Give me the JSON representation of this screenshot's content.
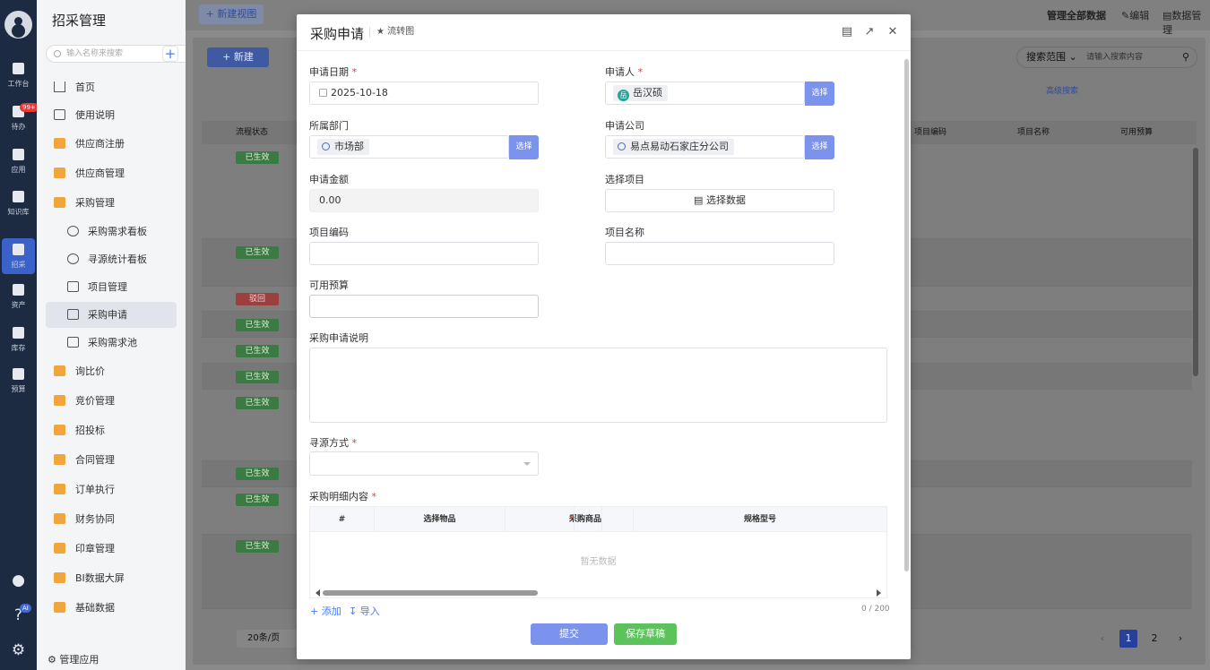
{
  "rail": {
    "items": [
      {
        "label": "工作台",
        "icon": "home-icon"
      },
      {
        "label": "待办",
        "icon": "todo-icon"
      },
      {
        "label": "应用",
        "icon": "apps-icon"
      },
      {
        "label": "知识库",
        "icon": "knowledge-icon"
      },
      {
        "label": "招采",
        "icon": "procurement-icon"
      },
      {
        "label": "资产",
        "icon": "assets-icon"
      },
      {
        "label": "库存",
        "icon": "inventory-icon"
      },
      {
        "label": "预算",
        "icon": "budget-icon"
      }
    ],
    "badge": "99+",
    "ai_badge": "AI"
  },
  "sidebar": {
    "title": "招采管理",
    "search_placeholder": "输入名称来搜索",
    "add": "+",
    "items": [
      {
        "label": "首页",
        "icon": "home-icon"
      },
      {
        "label": "使用说明",
        "icon": "document-icon"
      },
      {
        "label": "供应商注册",
        "icon": "folder-icon"
      },
      {
        "label": "供应商管理",
        "icon": "folder-icon"
      },
      {
        "label": "采购管理",
        "icon": "folder-open-icon"
      },
      {
        "label": "采购需求看板",
        "icon": "dashboard-icon"
      },
      {
        "label": "寻源统计看板",
        "icon": "dashboard-icon"
      },
      {
        "label": "项目管理",
        "icon": "document-icon"
      },
      {
        "label": "采购申请",
        "icon": "document-icon"
      },
      {
        "label": "采购需求池",
        "icon": "document-icon"
      },
      {
        "label": "询比价",
        "icon": "folder-icon"
      },
      {
        "label": "竞价管理",
        "icon": "folder-icon"
      },
      {
        "label": "招投标",
        "icon": "folder-icon"
      },
      {
        "label": "合同管理",
        "icon": "folder-icon"
      },
      {
        "label": "订单执行",
        "icon": "folder-icon"
      },
      {
        "label": "财务协同",
        "icon": "folder-icon"
      },
      {
        "label": "印章管理",
        "icon": "folder-icon"
      },
      {
        "label": "BI数据大屏",
        "icon": "folder-icon"
      },
      {
        "label": "基础数据",
        "icon": "folder-icon"
      }
    ],
    "footer": "管理应用"
  },
  "toolbar": {
    "new_view": "+ 新建视图",
    "manage_all": "管理全部数据",
    "edit": "编辑",
    "data_manage": "数据管理",
    "new_button": "+ 新建",
    "search_scope": "搜索范围",
    "search_placeholder": "请输入搜索内容",
    "advanced_search": "高级搜索"
  },
  "table": {
    "headers": {
      "status": "流程状态",
      "code": "项目编码",
      "name": "项目名称",
      "budget": "可用预算"
    },
    "rows": [
      {
        "status": "已生效"
      },
      {
        "status": "已生效"
      },
      {
        "status": "驳回"
      },
      {
        "status": "已生效"
      },
      {
        "status": "已生效"
      },
      {
        "status": "已生效"
      },
      {
        "status": "已生效"
      },
      {
        "status": "已生效"
      },
      {
        "status": "已生效"
      },
      {
        "status": "已生效"
      }
    ],
    "page_size": "20条/页",
    "pages": [
      "1",
      "2"
    ],
    "current_page": "1"
  },
  "modal": {
    "title": "采购申请",
    "flow_link": "流转图",
    "fields": {
      "apply_date": {
        "label": "申请日期",
        "value": "2025-10-18"
      },
      "applicant": {
        "label": "申请人",
        "value": "岳汉硕",
        "avatar": "岳"
      },
      "department": {
        "label": "所属部门",
        "value": "市场部"
      },
      "company": {
        "label": "申请公司",
        "value": "易点易动石家庄分公司"
      },
      "amount": {
        "label": "申请金额",
        "value": "0.00"
      },
      "project_select": {
        "label": "选择项目",
        "button": "选择数据"
      },
      "project_code": {
        "label": "项目编码",
        "value": ""
      },
      "project_name": {
        "label": "项目名称",
        "value": ""
      },
      "available_budget": {
        "label": "可用预算",
        "value": ""
      },
      "description": {
        "label": "采购申请说明",
        "value": ""
      },
      "sourcing": {
        "label": "寻源方式",
        "value": ""
      },
      "details": {
        "label": "采购明细内容"
      }
    },
    "pick_label": "选择",
    "detail_table": {
      "columns": [
        "#",
        "选择物品",
        "采购商品",
        "规格型号"
      ],
      "empty": "暂无数据"
    },
    "add": "添加",
    "import": "导入",
    "char_count": "0 / 200",
    "submit": "提交",
    "save_draft": "保存草稿"
  }
}
